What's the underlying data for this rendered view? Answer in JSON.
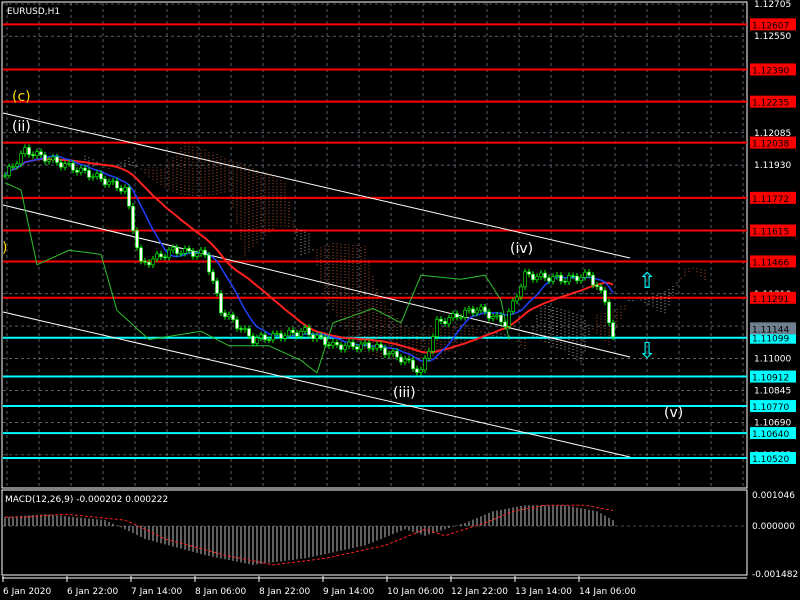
{
  "symbol": "EURUSD,H1",
  "macd_label": "MACD(12,26,9) -0.000202 0.000222",
  "price_axis": [
    "1.12705",
    "1.12550",
    "1.12085",
    "1.11930",
    "1.11310",
    "1.11155",
    "1.11000",
    "1.10845",
    "1.10690",
    "1.10535"
  ],
  "red_levels": [
    "1.12607",
    "1.12390",
    "1.12235",
    "1.12038",
    "1.11772",
    "1.11615",
    "1.11466",
    "1.11291"
  ],
  "cyan_levels": [
    "1.11099",
    "1.10912",
    "1.10770",
    "1.10640",
    "1.10520"
  ],
  "current_price": "1.11144",
  "macd_axis": [
    "0.001046",
    "0.000000",
    "-0.001482"
  ],
  "time_axis": [
    "6 Jan 2020",
    "6 Jan 22:00",
    "7 Jan 14:00",
    "8 Jan 06:00",
    "8 Jan 22:00",
    "9 Jan 14:00",
    "10 Jan 06:00",
    "12 Jan 22:00",
    "13 Jan 14:00",
    "14 Jan 06:00"
  ],
  "wave_labels": {
    "c": "(c)",
    "ii": "(ii)",
    "iii": "(iii)",
    "iv": "(iv)",
    "v": "(v)",
    "left": ")"
  },
  "colors": {
    "red": "#ff0000",
    "cyan": "#00ffff",
    "grid": "#8899aa",
    "candle": "#00ff00",
    "current": "#708090"
  },
  "price_path": [
    [
      0,
      1.1188
    ],
    [
      5,
      1.12
    ],
    [
      15,
      1.1193
    ],
    [
      22,
      1.1188
    ],
    [
      30,
      1.1181
    ],
    [
      34,
      1.1145
    ],
    [
      42,
      1.1152
    ],
    [
      50,
      1.115
    ],
    [
      54,
      1.1123
    ],
    [
      62,
      1.1109
    ],
    [
      75,
      1.1113
    ],
    [
      82,
      1.1106
    ],
    [
      92,
      1.1106
    ],
    [
      100,
      1.1099
    ],
    [
      104,
      1.1093
    ],
    [
      108,
      1.1117
    ],
    [
      118,
      1.1124
    ],
    [
      125,
      1.1117
    ],
    [
      130,
      1.114
    ],
    [
      140,
      1.1138
    ],
    [
      146,
      1.114
    ],
    [
      150,
      1.1128
    ],
    [
      152,
      1.1109
    ]
  ],
  "macd_path": [
    [
      0,
      0.0003
    ],
    [
      10,
      0.0004
    ],
    [
      25,
      0.0002
    ],
    [
      35,
      -0.0004
    ],
    [
      50,
      -0.0009
    ],
    [
      62,
      -0.0012
    ],
    [
      75,
      -0.001
    ],
    [
      90,
      -0.0006
    ],
    [
      100,
      -0.0001
    ],
    [
      105,
      -0.0003
    ],
    [
      115,
      0.0001
    ],
    [
      122,
      0.0005
    ],
    [
      130,
      0.0007
    ],
    [
      140,
      0.0007
    ],
    [
      148,
      0.0005
    ],
    [
      152,
      0.0002
    ]
  ]
}
